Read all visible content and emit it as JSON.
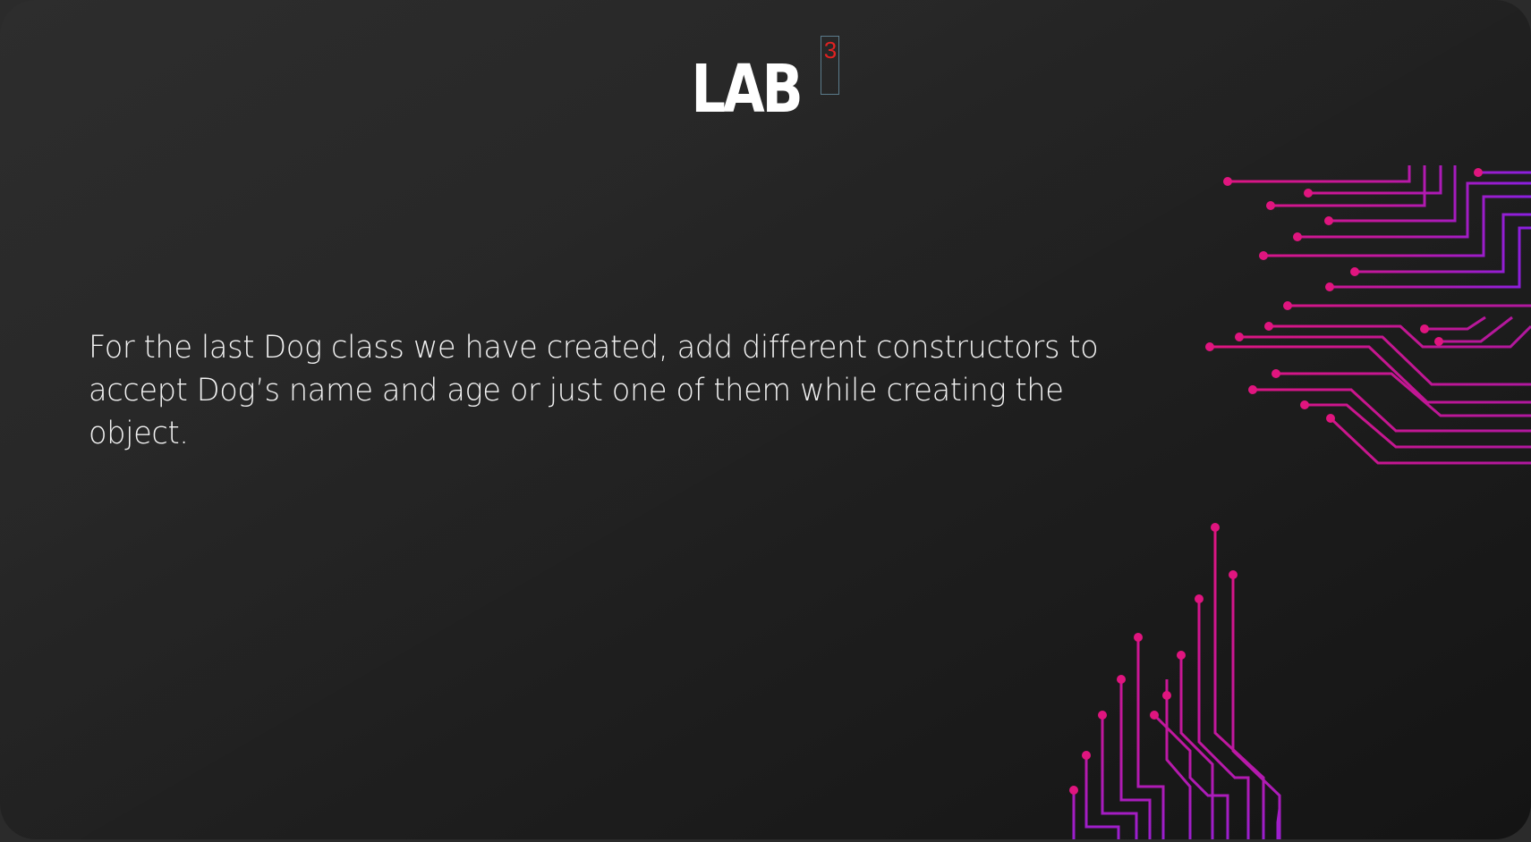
{
  "slide": {
    "title": "LAB",
    "slide_number": "3",
    "body": "For the last Dog class we have created, add different constructors to accept Dog’s name and age or just one of them while creating the object."
  },
  "colors": {
    "background": "#262626",
    "title": "#ffffff",
    "body_text": "#f2f2f2",
    "slide_number": "#e02020",
    "circuit_magenta": "#e0157f",
    "circuit_purple": "#8a1fe0"
  },
  "decorations": {
    "top_right": "circuit-traces-graphic",
    "bottom": "circuit-traces-graphic"
  }
}
